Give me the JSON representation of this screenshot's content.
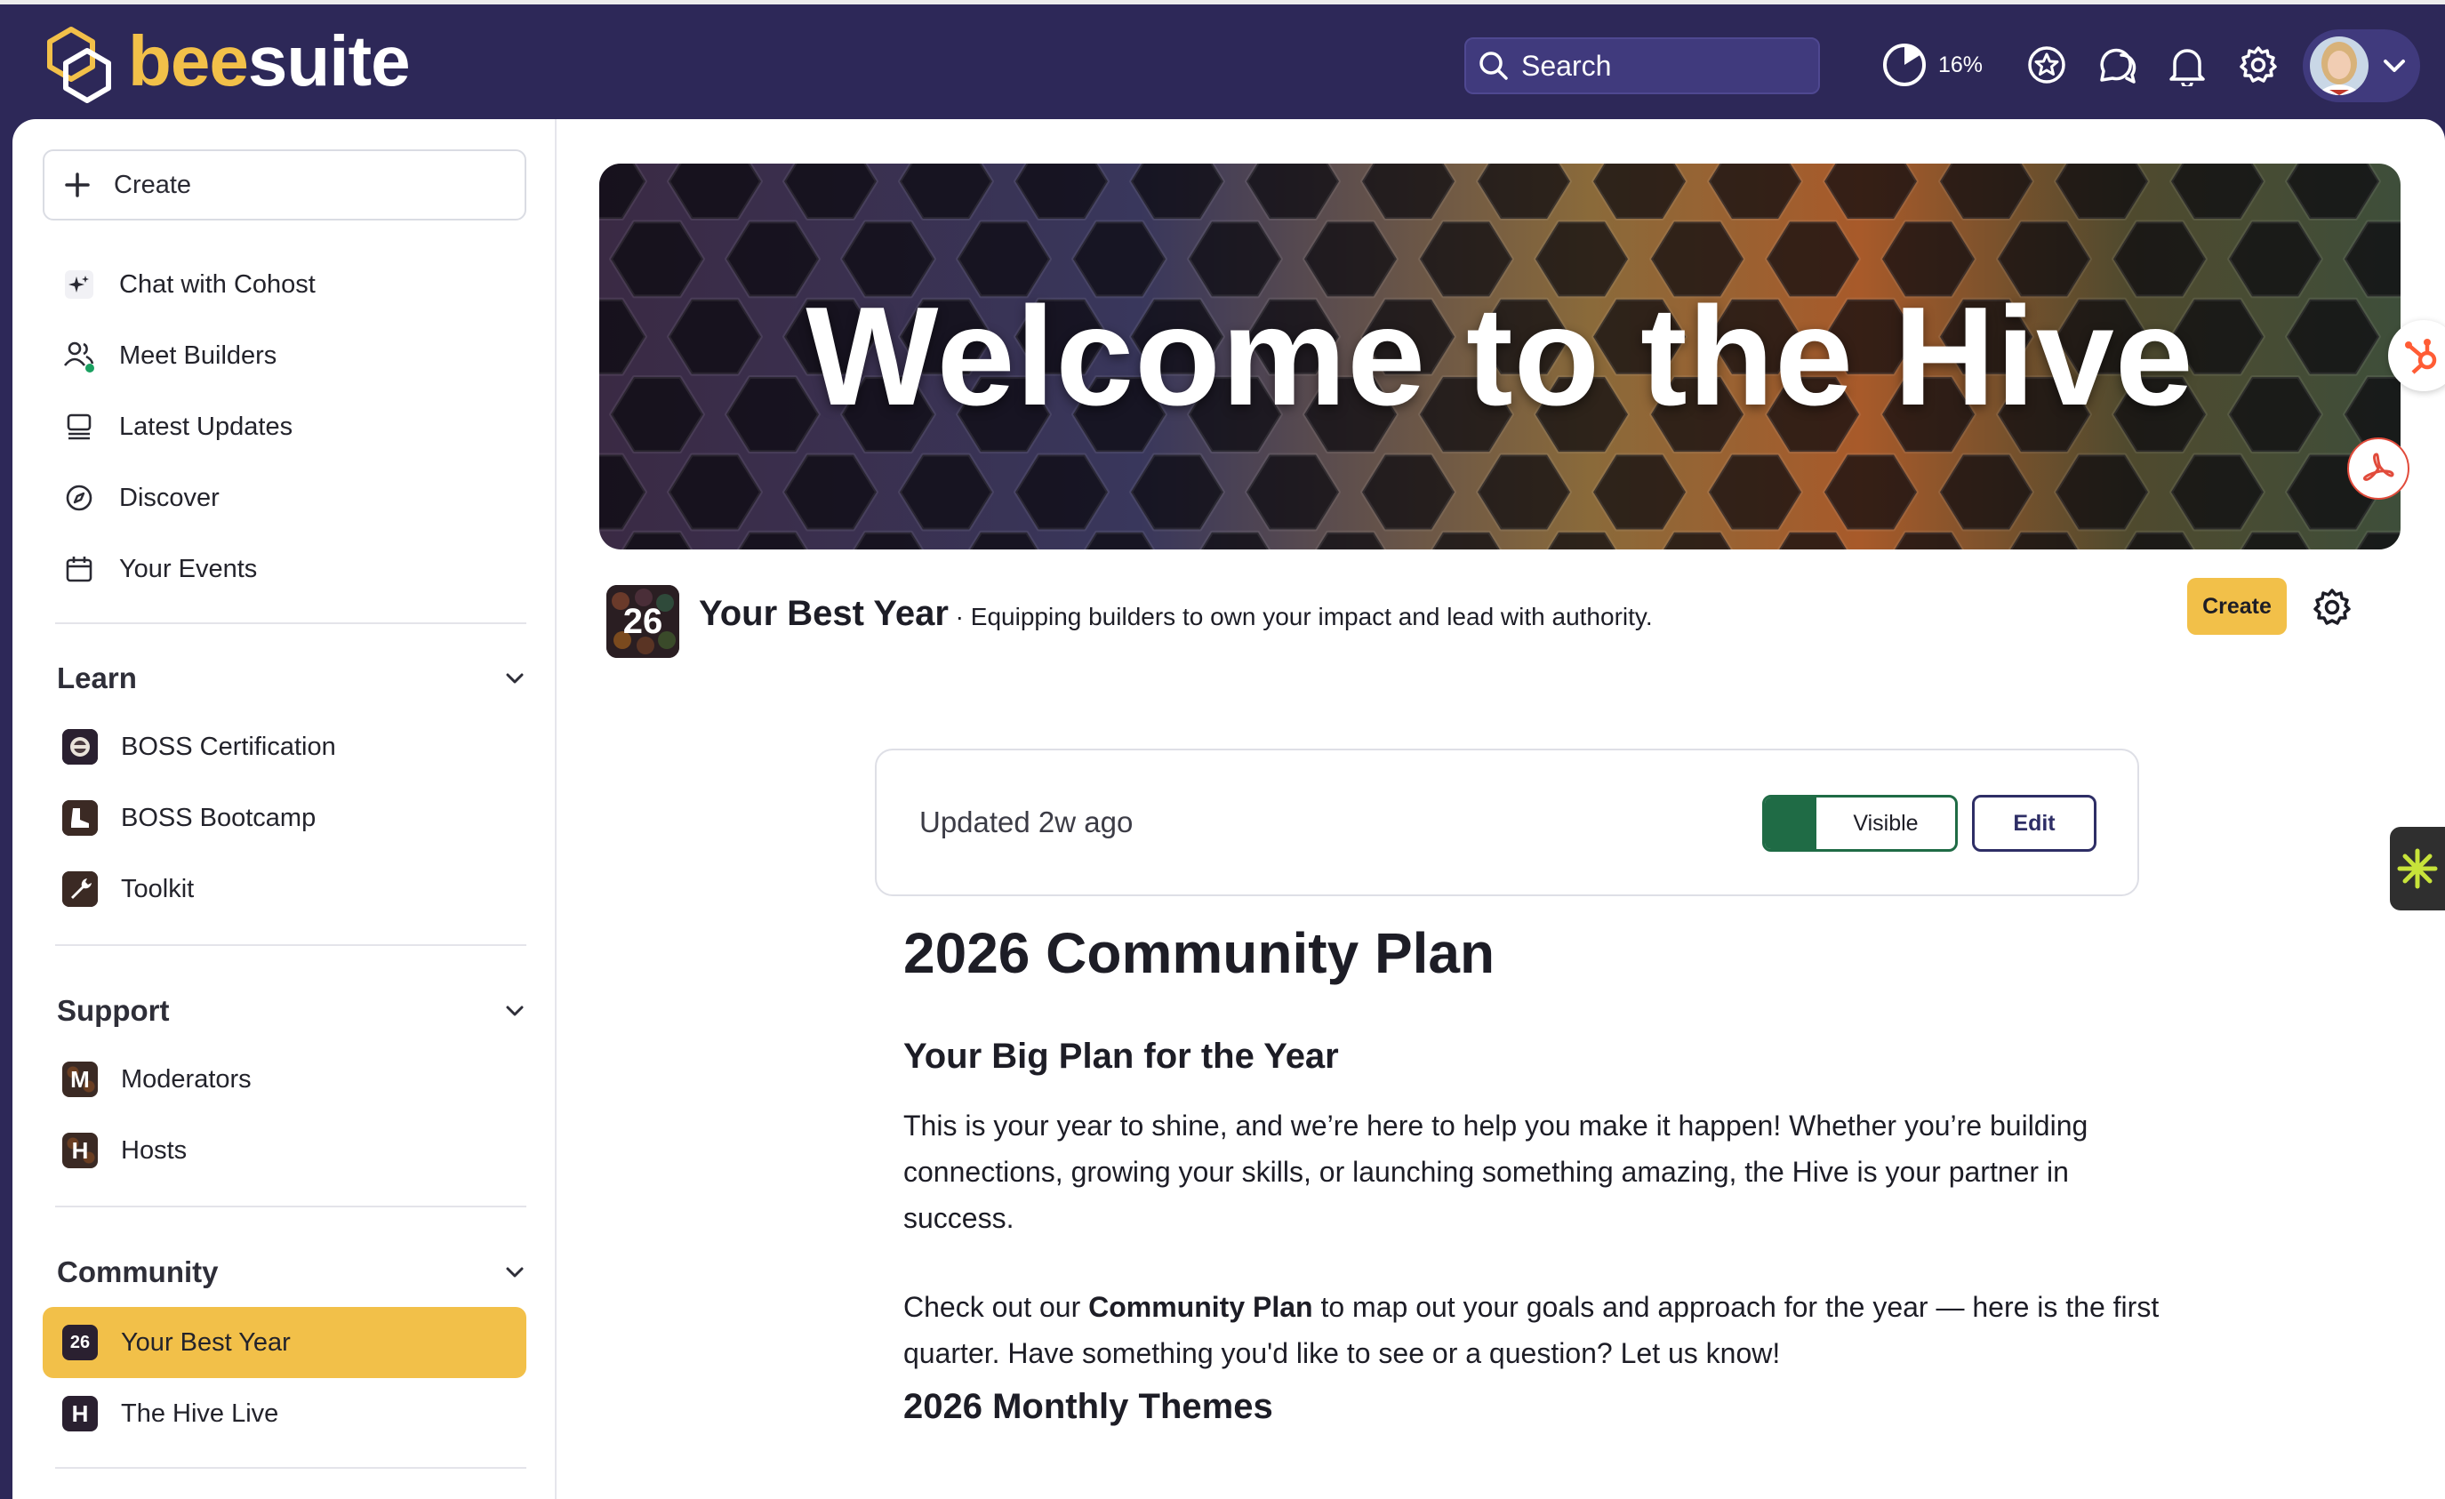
{
  "brand": {
    "name_part1": "bee",
    "name_part2": "suite",
    "accent": "#f2c049",
    "navy": "#2d2858"
  },
  "topbar": {
    "search": {
      "placeholder": "Search"
    },
    "progress": {
      "label": "16%",
      "value_percent": 16
    },
    "icons": [
      "progress-ring-icon",
      "star-badge-icon",
      "chat-bubbles-icon",
      "bell-icon",
      "gear-icon",
      "chevron-down-icon"
    ]
  },
  "sidebar": {
    "create_label": "Create",
    "top_items": [
      {
        "label": "Chat with Cohost",
        "icon": "sparkle-icon"
      },
      {
        "label": "Meet Builders",
        "icon": "people-icon"
      },
      {
        "label": "Latest Updates",
        "icon": "updates-icon"
      },
      {
        "label": "Discover",
        "icon": "compass-icon"
      },
      {
        "label": "Your Events",
        "icon": "calendar-icon"
      }
    ],
    "sections": [
      {
        "title": "Learn",
        "items": [
          {
            "label": "BOSS Certification"
          },
          {
            "label": "BOSS Bootcamp"
          },
          {
            "label": "Toolkit"
          }
        ]
      },
      {
        "title": "Support",
        "items": [
          {
            "label": "Moderators",
            "tile": "M"
          },
          {
            "label": "Hosts",
            "tile": "H"
          }
        ]
      },
      {
        "title": "Community",
        "items": [
          {
            "label": "Your Best Year",
            "tile": "26",
            "active": true
          },
          {
            "label": "The Hive Live",
            "tile": "H"
          }
        ]
      }
    ]
  },
  "hero": {
    "title": "Welcome to the Hive"
  },
  "space": {
    "logo_text": "26",
    "name": "Your Best Year",
    "separator": " · ",
    "description": "Equipping builders to own your impact and lead with authority.",
    "create_label": "Create"
  },
  "status_card": {
    "updated": "Updated 2w ago",
    "visible_label": "Visible",
    "edit_label": "Edit"
  },
  "article": {
    "title": "2026 Community Plan",
    "subtitle1": "Your Big Plan for the Year",
    "paragraph1": "This is your year to shine, and we’re here to help you make it happen! Whether you’re building connections, growing your skills, or launching something amazing, the Hive is your partner in success.",
    "p2_before": "Check out our ",
    "p2_bold": "Community Plan",
    "p2_after": " to map out your goals and approach for the year — here is the first quarter. Have something you'd like to see or a question? Let us know!",
    "subtitle2": "2026 Monthly Themes"
  }
}
